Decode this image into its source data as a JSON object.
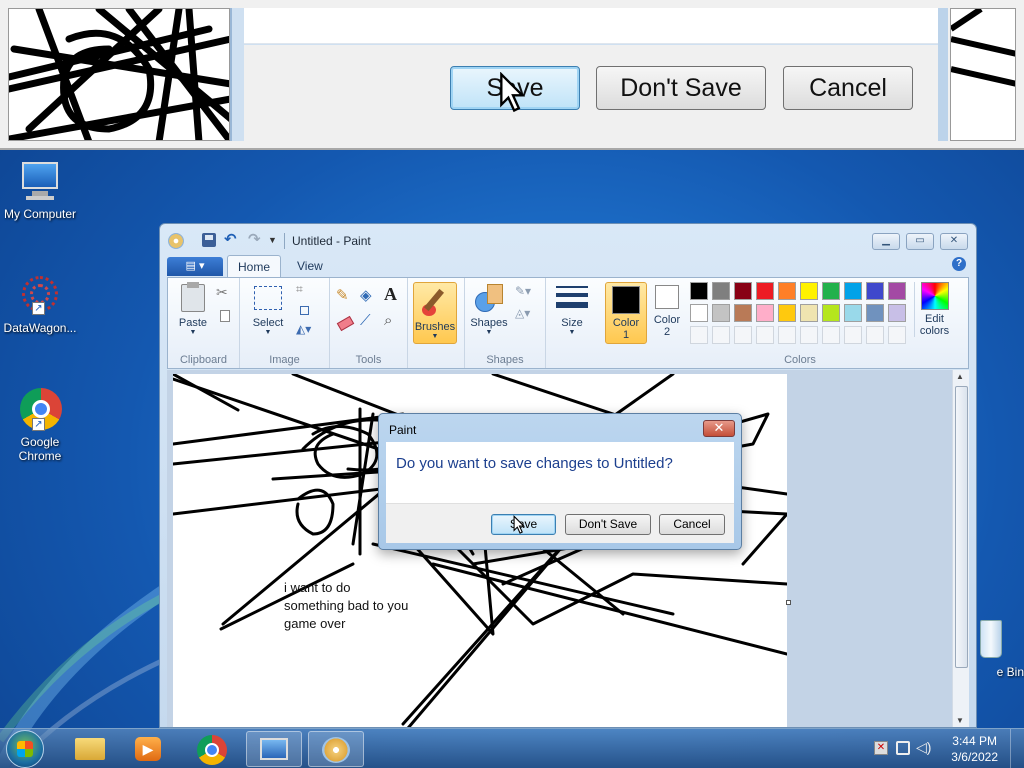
{
  "zoom": {
    "buttons": {
      "save": "Save",
      "dont_save": "Don't Save",
      "cancel": "Cancel"
    }
  },
  "desktop": {
    "icons": [
      {
        "label": "My Computer"
      },
      {
        "label": "DataWagon..."
      },
      {
        "label": "Google Chrome"
      },
      {
        "label": "e Bin"
      }
    ]
  },
  "paint": {
    "title": "Untitled - Paint",
    "tabs": {
      "home": "Home",
      "view": "View"
    },
    "ribbon": {
      "clipboard": {
        "paste": "Paste",
        "label": "Clipboard"
      },
      "image": {
        "select": "Select",
        "label": "Image"
      },
      "tools": {
        "label": "Tools"
      },
      "brushes": "Brushes",
      "shapes": {
        "button": "Shapes",
        "label": "Shapes"
      },
      "size": "Size",
      "color1": {
        "name": "Color",
        "num": "1"
      },
      "color2": {
        "name": "Color",
        "num": "2"
      },
      "colors_label": "Colors",
      "edit_colors": {
        "line1": "Edit",
        "line2": "colors"
      }
    },
    "palette": [
      "#000000",
      "#7f7f7f",
      "#880015",
      "#ed1c24",
      "#ff7f27",
      "#fff200",
      "#22b14c",
      "#00a2e8",
      "#3f48cc",
      "#a349a4",
      "#ffffff",
      "#c3c3c3",
      "#b97a57",
      "#ffaec9",
      "#ffc90e",
      "#efe4b0",
      "#b5e61d",
      "#99d9ea",
      "#7092be",
      "#c8bfe7"
    ],
    "canvas_text": "i want to do\nsomething bad to you\ngame over"
  },
  "dialog": {
    "title": "Paint",
    "message": "Do you want to save changes to Untitled?",
    "buttons": {
      "save": "Save",
      "dont_save": "Don't Save",
      "cancel": "Cancel"
    }
  },
  "taskbar": {
    "time": "3:44 PM",
    "date": "3/6/2022"
  }
}
